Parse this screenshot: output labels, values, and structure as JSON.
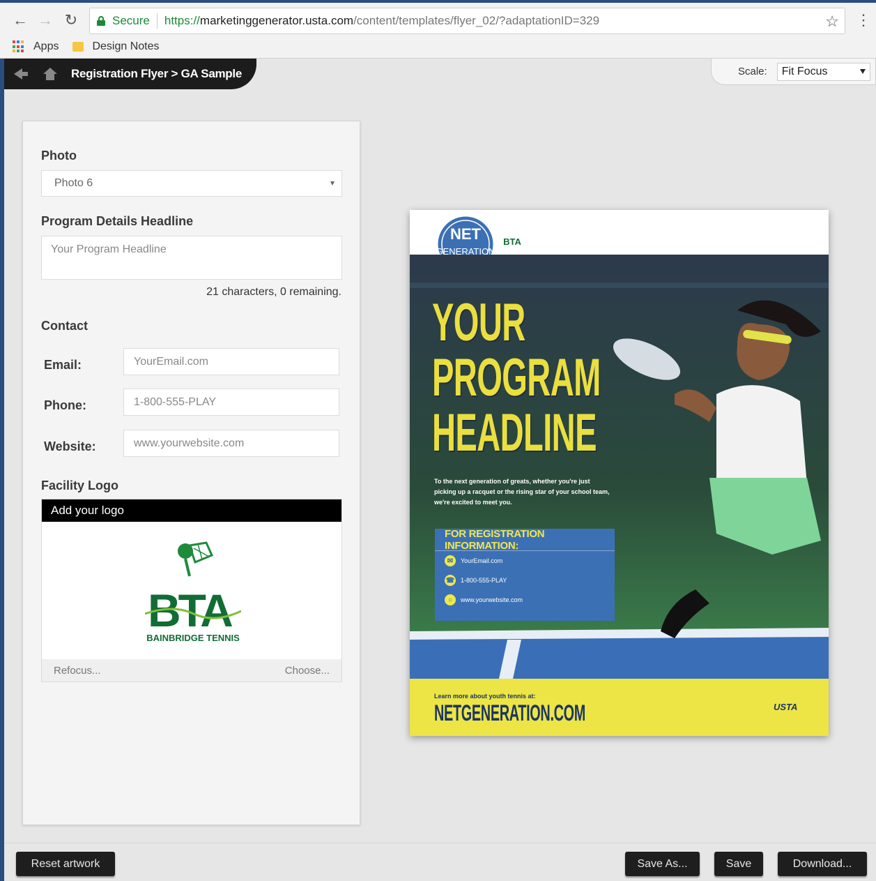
{
  "browser": {
    "secure_label": "Secure",
    "url_scheme": "https://",
    "url_host": "marketinggenerator.usta.com",
    "url_path": "/content/templates/flyer_02/?adaptationID=329",
    "bookmarks": [
      "Apps",
      "Design Notes"
    ]
  },
  "header": {
    "breadcrumb": "Registration Flyer > GA Sample",
    "scale_label": "Scale:",
    "scale_value": "Fit Focus"
  },
  "panel": {
    "photo_label": "Photo",
    "photo_value": "Photo 6",
    "headline_label": "Program Details Headline",
    "headline_placeholder": "Your Program Headline",
    "char_count": "21 characters, 0 remaining.",
    "contact_label": "Contact",
    "email_label": "Email:",
    "email_placeholder": "YourEmail.com",
    "phone_label": "Phone:",
    "phone_placeholder": "1-800-555-PLAY",
    "website_label": "Website:",
    "website_placeholder": "www.yourwebsite.com",
    "logo_label": "Facility Logo",
    "logo_header": "Add your logo",
    "logo_text": "BAINBRIDGE TENNIS",
    "refocus": "Refocus...",
    "choose": "Choose..."
  },
  "flyer": {
    "headline": [
      "YOUR",
      "PROGRAM",
      "HEADLINE"
    ],
    "blurb": "To the next generation of greats, whether you're just picking up a racquet or the rising star of your school team, we're excited to meet you.",
    "reg_title": "FOR REGISTRATION INFORMATION:",
    "reg_email": "YourEmail.com",
    "reg_phone": "1-800-555-PLAY",
    "reg_web": "www.yourwebsite.com",
    "learn_more": "Learn more about youth tennis at:",
    "site": "NETGENERATION.COM",
    "usta": "USTA"
  },
  "toolbar": {
    "reset": "Reset artwork",
    "save_as": "Save As...",
    "save": "Save",
    "download": "Download..."
  },
  "icons": [
    "back-arrow-icon",
    "forward-arrow-icon",
    "reload-icon",
    "lock-icon",
    "star-icon",
    "menu-icon",
    "apps-icon",
    "folder-icon",
    "home-icon",
    "dropdown-icon"
  ],
  "colors": {
    "accent_blue": "#2b4c7e",
    "flyer_yellow": "#eadf3e",
    "flyer_navy": "#1c3563",
    "reg_blue": "#3c70b5"
  }
}
